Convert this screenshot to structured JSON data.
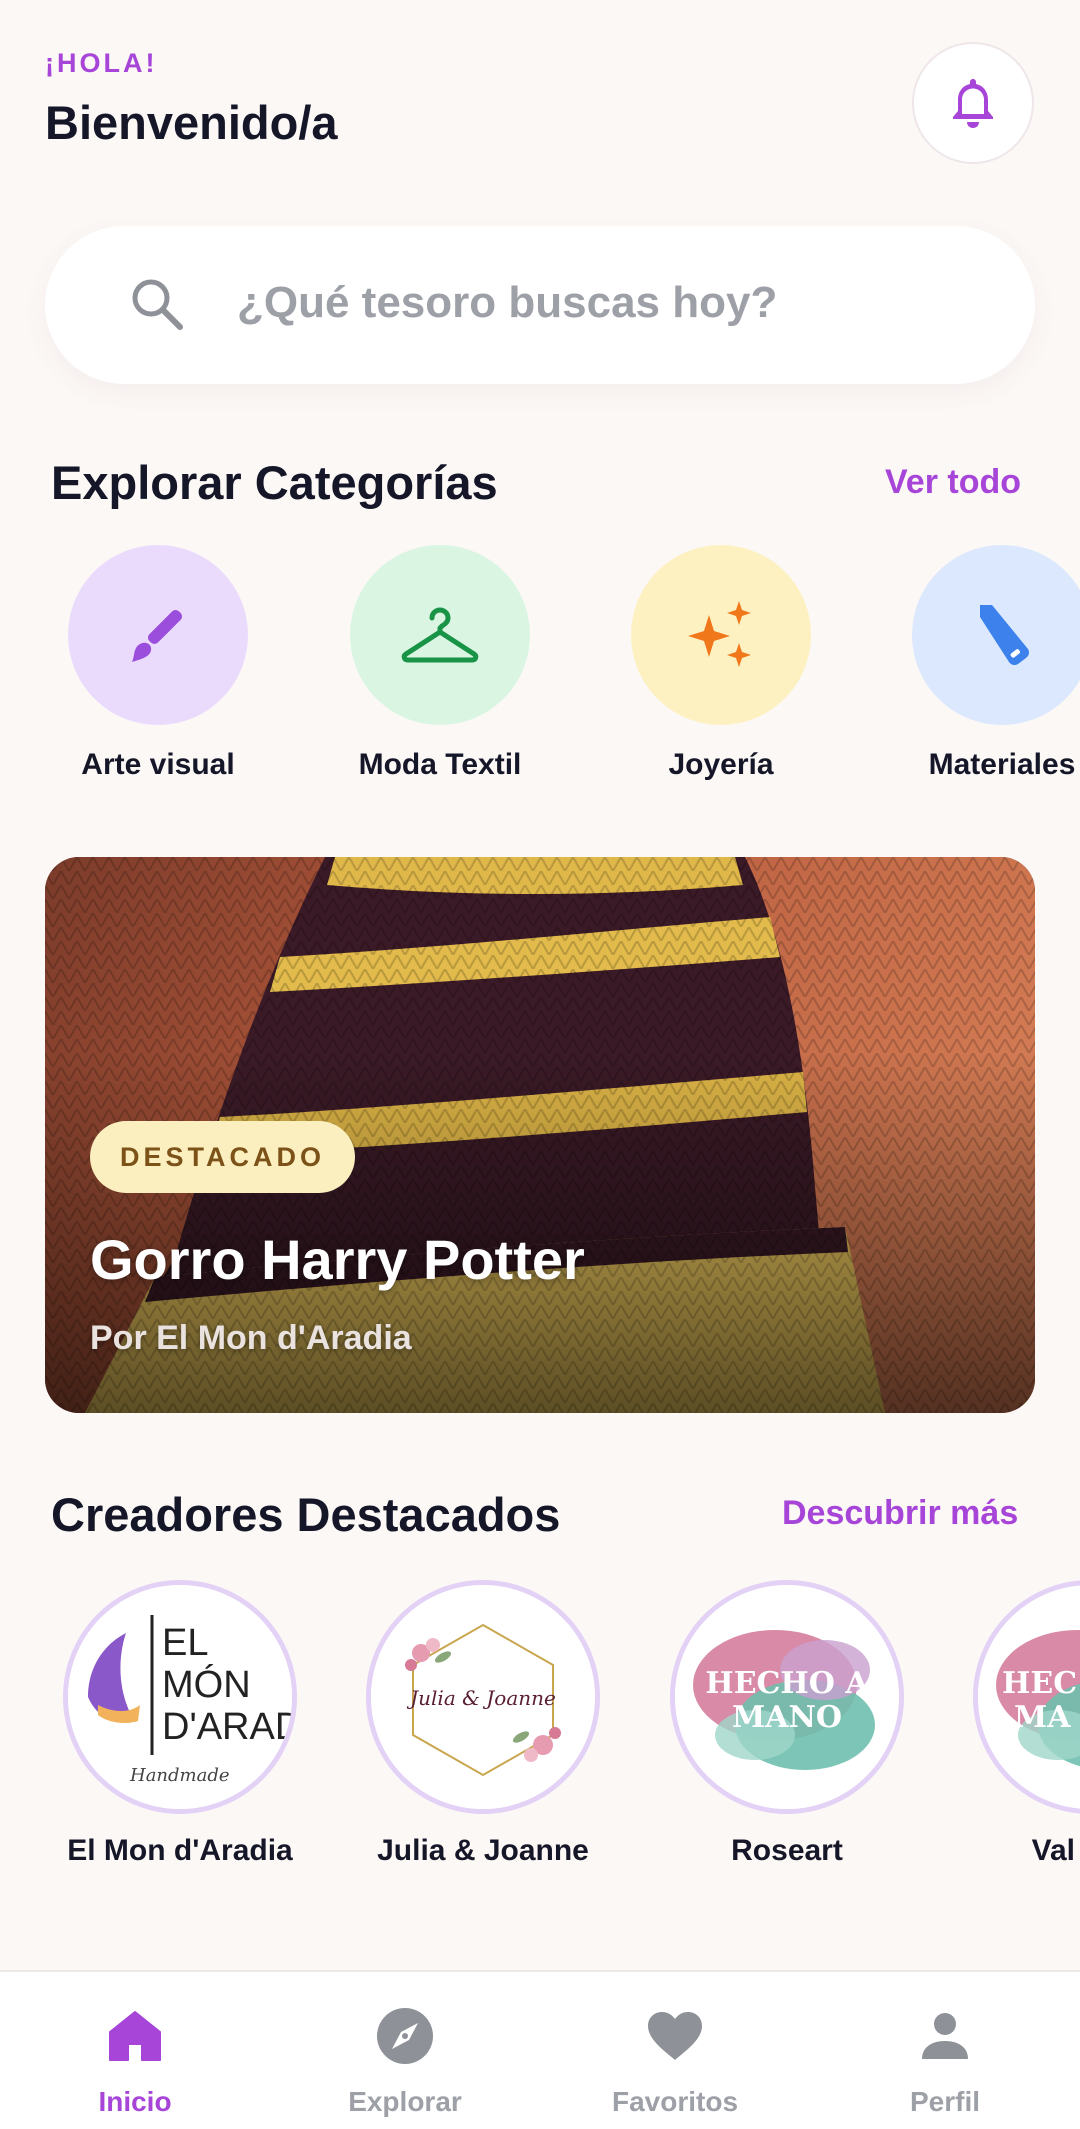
{
  "header": {
    "greeting": "¡HOLA!",
    "welcome": "Bienvenido/a"
  },
  "search": {
    "placeholder": "¿Qué tesoro buscas hoy?"
  },
  "categories": {
    "title": "Explorar Categorías",
    "see_all": "Ver todo",
    "items": [
      {
        "label": "Arte visual",
        "icon": "paint-brush-icon",
        "bg": "#eadbfd",
        "color": "#9b4ddb"
      },
      {
        "label": "Moda Textil",
        "icon": "hanger-icon",
        "bg": "#daf6e3",
        "color": "#199447"
      },
      {
        "label": "Joyería",
        "icon": "sparkles-icon",
        "bg": "#fdf1c2",
        "color": "#f0771a"
      },
      {
        "label": "Materiales",
        "icon": "utility-knife-icon",
        "bg": "#dbe8fd",
        "color": "#3d82ec"
      }
    ]
  },
  "featured": {
    "badge": "DESTACADO",
    "title": "Gorro Harry Potter",
    "subtitle": "Por El Mon d'Aradia"
  },
  "creators": {
    "title": "Creadores Destacados",
    "discover": "Descubrir más",
    "items": [
      {
        "name": "El Mon d'Aradia",
        "logo_text": [
          "EL",
          "MÓN",
          "D'ARAD",
          "Handmade"
        ]
      },
      {
        "name": "Julia & Joanne",
        "logo_text": [
          "Julia & Joanne"
        ]
      },
      {
        "name": "Roseart",
        "logo_text": [
          "HECHO A",
          "MANO"
        ]
      },
      {
        "name": "Val Fern",
        "logo_text": [
          "HEC",
          "MA"
        ]
      }
    ]
  },
  "nav": {
    "items": [
      {
        "label": "Inicio",
        "icon": "home-icon",
        "active": true
      },
      {
        "label": "Explorar",
        "icon": "compass-icon",
        "active": false
      },
      {
        "label": "Favoritos",
        "icon": "heart-icon",
        "active": false
      },
      {
        "label": "Perfil",
        "icon": "user-icon",
        "active": false
      }
    ]
  },
  "colors": {
    "accent": "#a745d8",
    "text": "#151729",
    "muted": "#9da0a7",
    "background": "#fcf8f6"
  }
}
